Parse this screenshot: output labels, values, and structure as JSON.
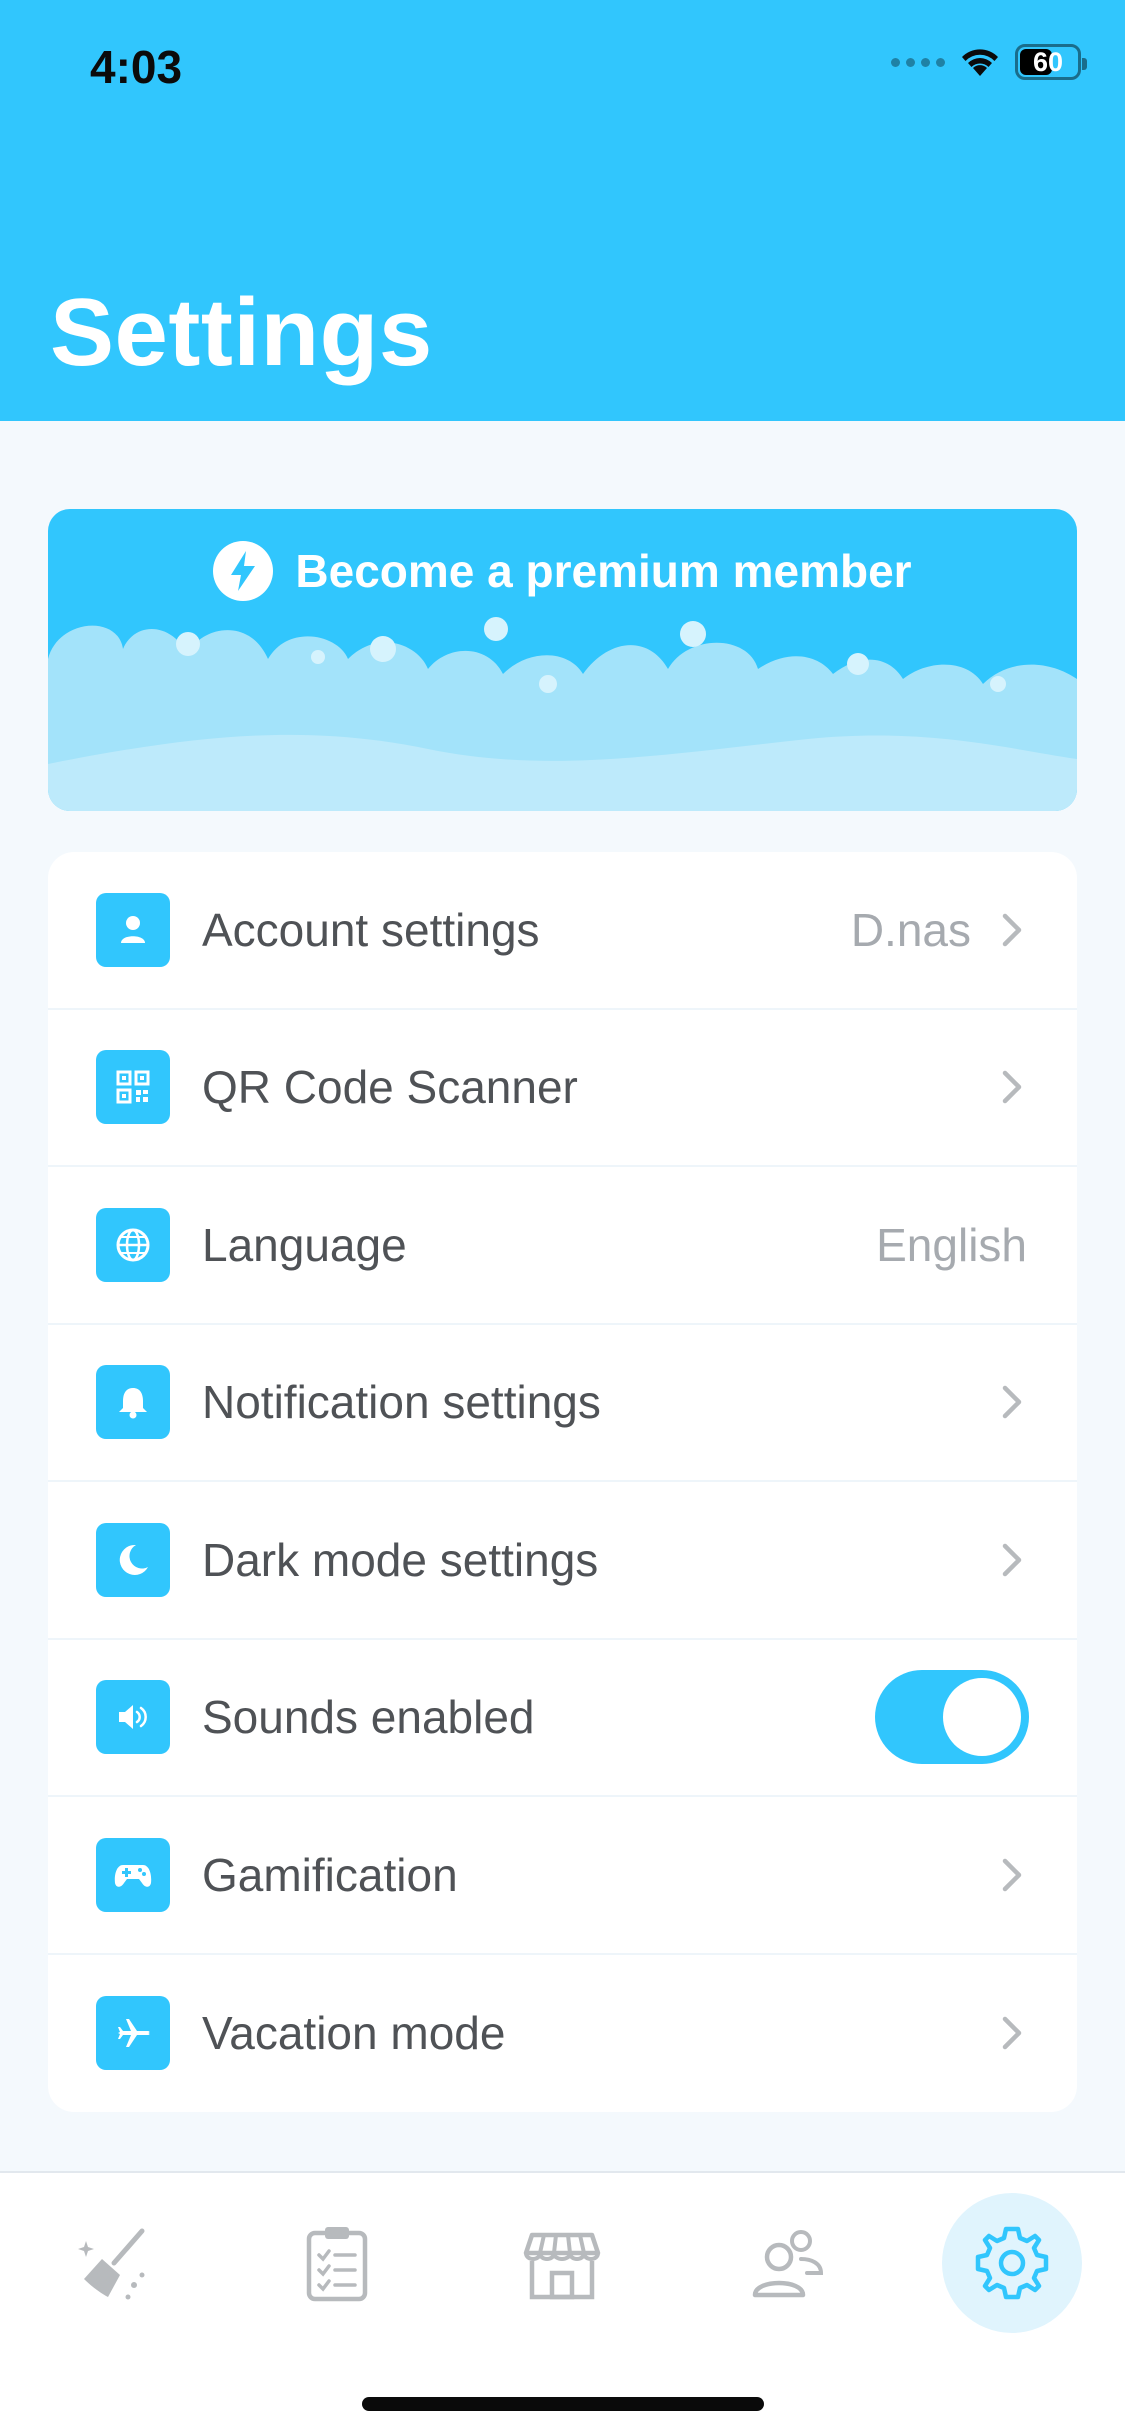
{
  "status_bar": {
    "time": "4:03",
    "battery": "60",
    "battery_level": 0.6
  },
  "header": {
    "title": "Settings"
  },
  "premium_banner": {
    "label": "Become a premium member",
    "icon": "lightning-bolt-icon"
  },
  "settings": [
    {
      "label": "Account settings",
      "value": "D.nas",
      "icon": "person-icon",
      "chevron": true
    },
    {
      "label": "QR Code Scanner",
      "value": "",
      "icon": "qr-code-icon",
      "chevron": true
    },
    {
      "label": "Language",
      "value": "English",
      "icon": "globe-icon",
      "chevron": false
    },
    {
      "label": "Notification settings",
      "value": "",
      "icon": "bell-icon",
      "chevron": true
    },
    {
      "label": "Dark mode settings",
      "value": "",
      "icon": "moon-icon",
      "chevron": true
    },
    {
      "label": "Sounds enabled",
      "value": "",
      "icon": "speaker-icon",
      "toggle": true,
      "toggle_on": true
    },
    {
      "label": "Gamification",
      "value": "",
      "icon": "gamepad-icon",
      "chevron": true
    },
    {
      "label": "Vacation mode",
      "value": "",
      "icon": "airplane-icon",
      "chevron": true
    }
  ],
  "tab_bar": {
    "tabs": [
      {
        "icon": "broom-icon",
        "active": false
      },
      {
        "icon": "clipboard-checklist-icon",
        "active": false
      },
      {
        "icon": "store-icon",
        "active": false
      },
      {
        "icon": "users-icon",
        "active": false
      },
      {
        "icon": "gear-icon",
        "active": true
      }
    ]
  },
  "colors": {
    "accent": "#31c6fd",
    "background": "#f4f9fd",
    "text": "#4f5256",
    "secondary_text": "#a6aaaf",
    "inactive_icon": "#b7babd"
  }
}
